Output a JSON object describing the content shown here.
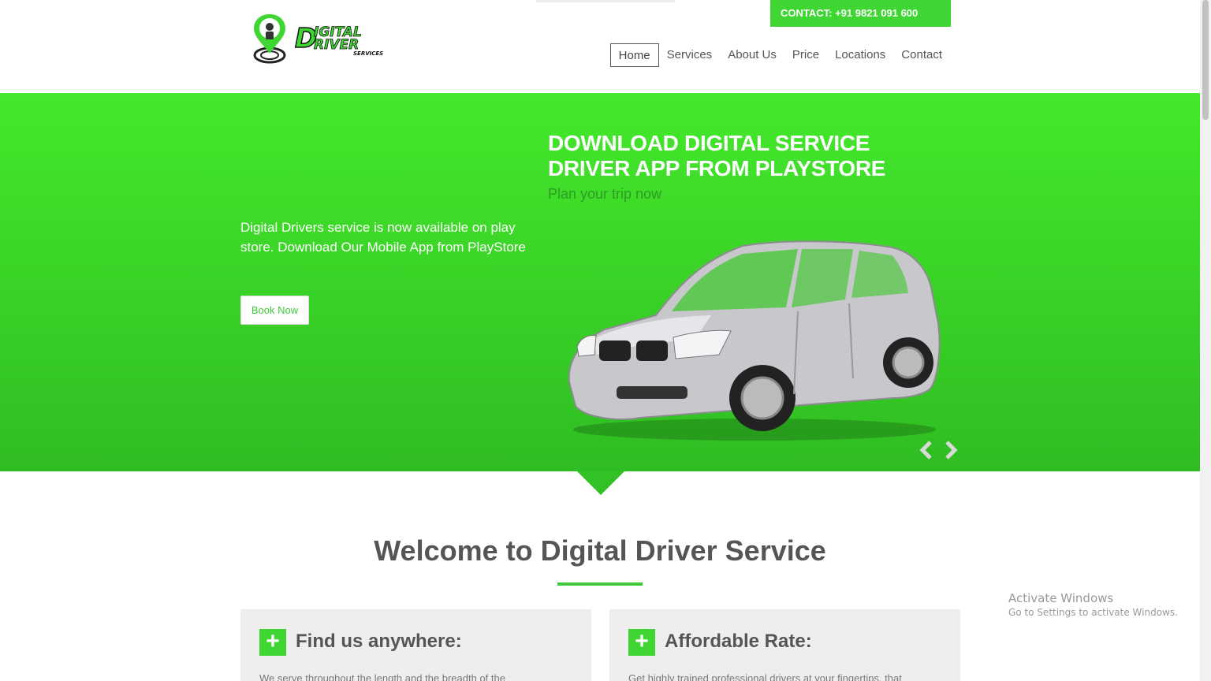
{
  "header": {
    "contact": "CONTACT: +91 9821 091 600",
    "logo_text": "DIGITAL DRIVER",
    "logo_subtext": "SERVICES",
    "nav": [
      {
        "label": "Home",
        "active": true
      },
      {
        "label": "Services"
      },
      {
        "label": "About Us"
      },
      {
        "label": "Price"
      },
      {
        "label": "Locations"
      },
      {
        "label": "Contact"
      }
    ]
  },
  "hero": {
    "text": "Digital Drivers service is now available on play store. Download Our Mobile App from PlayStore",
    "button": "Book Now",
    "title": "DOWNLOAD DIGITAL SERVICE DRIVER APP FROM PLAYSTORE",
    "subtitle": "Plan your trip now",
    "prev_icon": "chevron-left-icon",
    "next_icon": "chevron-right-icon"
  },
  "welcome": {
    "title": "Welcome to Digital Driver Service"
  },
  "features": [
    {
      "title": "Find us anywhere:",
      "text": "We serve throughout the length and the breadth of the",
      "icon": "plus-icon"
    },
    {
      "title": "Affordable Rate:",
      "text": "Get highly trained professional drivers at your fingertips, that",
      "icon": "plus-icon"
    }
  ],
  "watermark": {
    "title": "Activate Windows",
    "subtitle": "Go to Settings to activate Windows."
  },
  "colors": {
    "accent": "#3fd633",
    "hero_top": "#45e82c",
    "hero_bottom": "#2fbd22"
  }
}
